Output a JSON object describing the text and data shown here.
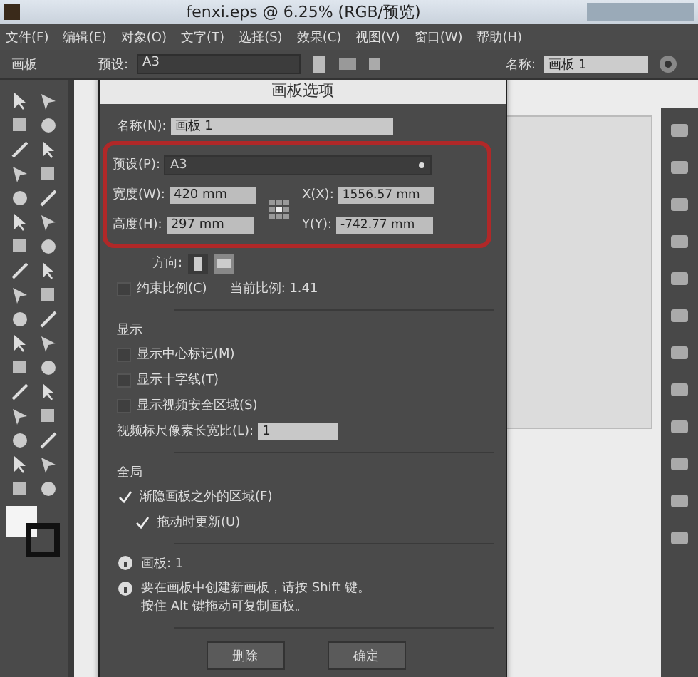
{
  "window": {
    "title": "fenxi.eps @ 6.25% (RGB/预览)"
  },
  "menu": [
    "文件(F)",
    "编辑(E)",
    "对象(O)",
    "文字(T)",
    "选择(S)",
    "效果(C)",
    "视图(V)",
    "窗口(W)",
    "帮助(H)"
  ],
  "control_bar": {
    "mode": "画板",
    "preset_label": "预设:",
    "preset": "A3",
    "name_label": "名称:",
    "name": "画板 1"
  },
  "dialog": {
    "title": "画板选项",
    "name_label": "名称(N):",
    "name": "画板 1",
    "preset_label": "预设(P):",
    "preset": "A3",
    "width_label": "宽度(W):",
    "width": "420 mm",
    "height_label": "高度(H):",
    "height": "297 mm",
    "x_label": "X(X):",
    "x": "1556.57 mm",
    "y_label": "Y(Y):",
    "y": "-742.77 mm",
    "orientation_label": "方向:",
    "orientation": [
      {
        "kind": "portrait",
        "selected": false
      },
      {
        "kind": "landscape",
        "selected": true
      }
    ],
    "constrain": {
      "label": "约束比例(C)",
      "checked": false
    },
    "ratio_label": "当前比例: 1.41",
    "display_heading": "显示",
    "display_options": [
      {
        "label": "显示中心标记(M)",
        "checked": false
      },
      {
        "label": "显示十字线(T)",
        "checked": false
      },
      {
        "label": "显示视频安全区域(S)",
        "checked": false
      }
    ],
    "pixel_ratio_label": "视频标尺像素长宽比(L):",
    "pixel_ratio": "1",
    "global_heading": "全局",
    "global_options": [
      {
        "label": "渐隐画板之外的区域(F)",
        "checked": true,
        "indented": false
      },
      {
        "label": "拖动时更新(U)",
        "checked": true,
        "indented": true
      }
    ],
    "artboards": "画板: 1",
    "hint_lines": [
      "要在画板中创建新画板，请按 Shift 键。",
      "按住 Alt 键拖动可复制画板。"
    ],
    "buttons": [
      "删除",
      "确定"
    ]
  }
}
